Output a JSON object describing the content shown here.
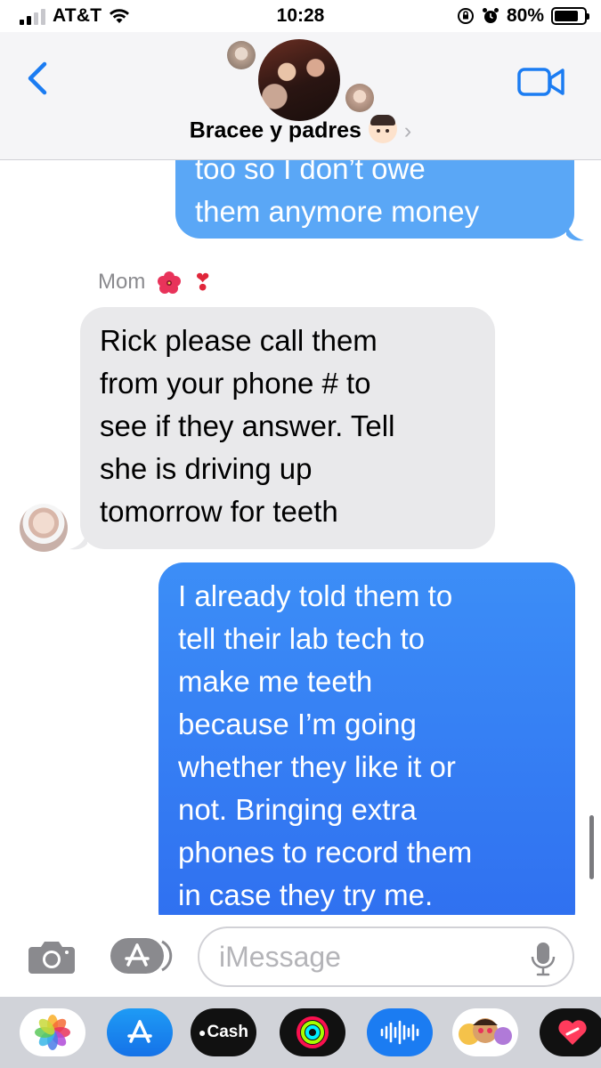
{
  "status_bar": {
    "carrier": "AT&T",
    "time": "10:28",
    "battery_percent": "80%",
    "battery_level": 0.8,
    "signal_bars": 2,
    "icons": [
      "signal-icon",
      "wifi-icon",
      "screen-lock-rotation-icon",
      "alarm-icon",
      "battery-icon"
    ]
  },
  "header": {
    "group_name": "Bracee y padres",
    "chevron": "›",
    "back_icon": "chevron-left-icon",
    "video_icon": "video-camera-icon"
  },
  "messages": [
    {
      "direction": "sent",
      "lines": [
        "too so I don’t owe",
        "them anymore money"
      ]
    },
    {
      "direction": "received",
      "sender": "Mom",
      "sender_emoji": [
        "hibiscus-icon",
        "exclamation-heart-icon"
      ],
      "lines": [
        "Rick please call them",
        "from your phone # to",
        "see if they answer. Tell",
        "she is driving up",
        "tomorrow for teeth"
      ]
    },
    {
      "direction": "sent",
      "lines": [
        "I already told them to",
        "tell their lab tech to",
        "make me teeth",
        "because I’m going",
        "whether they like it or",
        "not. Bringing extra",
        "phones to record them",
        "in case they try me."
      ]
    }
  ],
  "input_bar": {
    "placeholder": "iMessage",
    "value": "",
    "icons": [
      "camera-icon",
      "app-store-icon",
      "microphone-icon"
    ]
  },
  "app_drawer": {
    "apps": [
      {
        "name": "Photos",
        "icon": "photos-icon"
      },
      {
        "name": "App Store",
        "icon": "app-store-icon"
      },
      {
        "name": "Cash",
        "label": "Cash",
        "icon": "apple-cash-icon"
      },
      {
        "name": "Activity",
        "icon": "activity-rings-icon"
      },
      {
        "name": "Audio",
        "icon": "audio-message-icon"
      },
      {
        "name": "Memoji",
        "icon": "memoji-icon"
      },
      {
        "name": "Digital Touch",
        "icon": "digital-touch-icon"
      }
    ]
  },
  "colors": {
    "sent_bubble_top": "#5aa7f6",
    "sent_bubble": "#2f6ff0",
    "received_bubble": "#e9e9eb",
    "ios_blue": "#1b7cf2",
    "header_bg": "#f5f5f7"
  }
}
